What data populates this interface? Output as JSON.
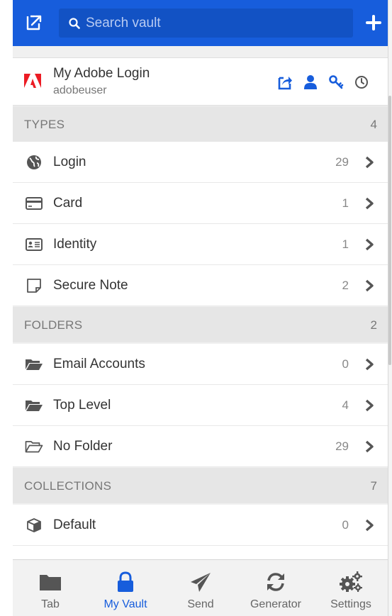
{
  "header": {
    "search_placeholder": "Search vault"
  },
  "featured": {
    "title": "My Adobe Login",
    "subtitle": "adobeuser",
    "actions": [
      "launch-icon",
      "copy-username-icon",
      "copy-password-icon",
      "totp-icon"
    ]
  },
  "sections": {
    "types": {
      "title": "TYPES",
      "count": "4",
      "items": [
        {
          "label": "Login",
          "count": "29",
          "icon": "globe-icon"
        },
        {
          "label": "Card",
          "count": "1",
          "icon": "card-icon"
        },
        {
          "label": "Identity",
          "count": "1",
          "icon": "id-card-icon"
        },
        {
          "label": "Secure Note",
          "count": "2",
          "icon": "note-icon"
        }
      ]
    },
    "folders": {
      "title": "FOLDERS",
      "count": "2",
      "items": [
        {
          "label": "Email Accounts",
          "count": "0",
          "icon": "folder-open-icon"
        },
        {
          "label": "Top Level",
          "count": "4",
          "icon": "folder-open-icon"
        },
        {
          "label": "No Folder",
          "count": "29",
          "icon": "folder-outline-icon"
        }
      ]
    },
    "collections": {
      "title": "COLLECTIONS",
      "count": "7",
      "items": [
        {
          "label": "Default",
          "count": "0",
          "icon": "cube-icon"
        }
      ]
    }
  },
  "nav": {
    "tabs": [
      {
        "label": "Tab",
        "icon": "folder-icon",
        "active": false
      },
      {
        "label": "My Vault",
        "icon": "lock-icon",
        "active": true
      },
      {
        "label": "Send",
        "icon": "paper-plane-icon",
        "active": false
      },
      {
        "label": "Generator",
        "icon": "refresh-icon",
        "active": false
      },
      {
        "label": "Settings",
        "icon": "cogs-icon",
        "active": false
      }
    ]
  },
  "colors": {
    "brand": "#175ddc",
    "header_bg": "#175ddc",
    "adobe_red": "#ec1c24"
  }
}
